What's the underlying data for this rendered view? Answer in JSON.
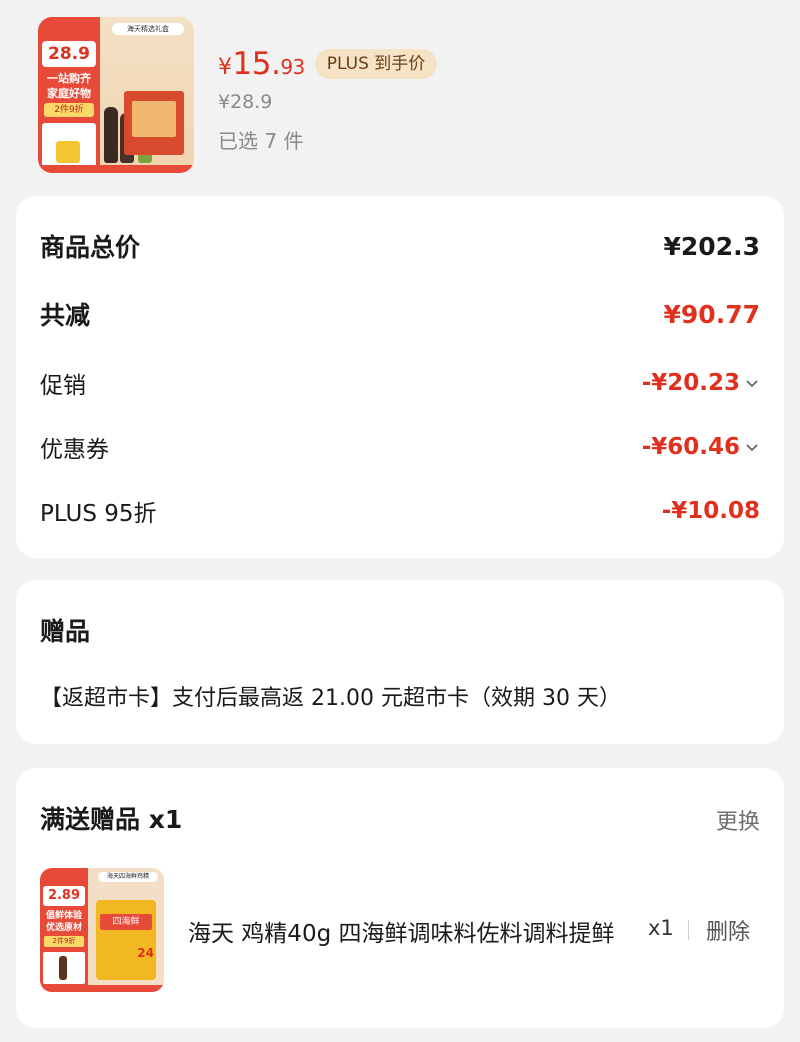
{
  "product": {
    "thumb": {
      "price": "28.9",
      "slogan_line1": "一站购齐",
      "slogan_line2": "家庭好物",
      "tag": "2件9折",
      "header": "海天精选礼盒"
    },
    "price_yen": "¥",
    "price_int": "15.",
    "price_dec": "93",
    "plus_badge": "PLUS 到手价",
    "original_price": "¥28.9",
    "selected": "已选 7 件"
  },
  "summary": {
    "total_label": "商品总价",
    "total_value": "¥202.3",
    "reduce_label": "共减",
    "reduce_value": "¥90.77",
    "promo_label": "促销",
    "promo_value": "-¥20.23",
    "coupon_label": "优惠券",
    "coupon_value": "-¥60.46",
    "plus_label": "PLUS 95折",
    "plus_value": "-¥10.08"
  },
  "gift": {
    "title": "赠品",
    "description": "【返超市卡】支付后最高返 21.00 元超市卡（效期 30 天）"
  },
  "full_gift": {
    "title": "满送赠品 x1",
    "change": "更换",
    "thumb": {
      "price": "2.89",
      "slogan": "倡鲜体验 优选原材",
      "tag": "2件9折",
      "header": "海天四海鲜鸡精",
      "bag_label": "四海鲜",
      "bag_count": "24"
    },
    "item_name": "海天 鸡精40g 四海鲜调味料佐料调料提鲜",
    "qty": "x1",
    "delete": "删除"
  },
  "colors": {
    "accent_red": "#e0301e",
    "plus_badge_bg": "#f6e3c6",
    "background": "#f2f2f2",
    "card": "#ffffff"
  }
}
